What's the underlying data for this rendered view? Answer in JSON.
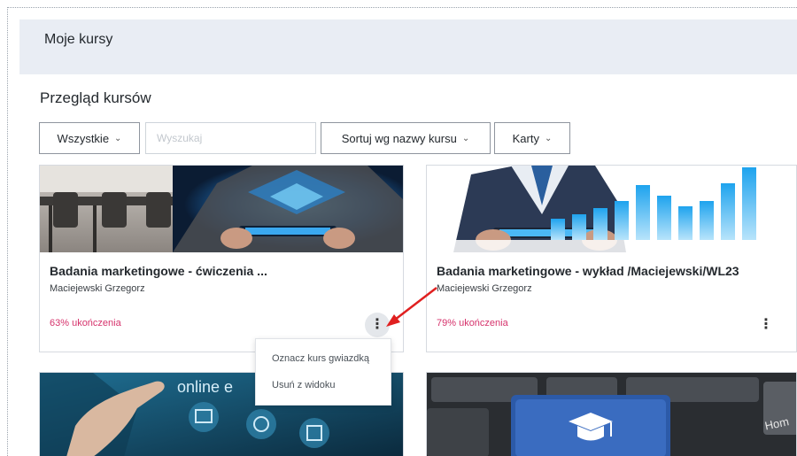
{
  "header": {
    "title": "Moje kursy"
  },
  "overview": {
    "title": "Przegląd kursów",
    "filter_label": "Wszystkie",
    "search_placeholder": "Wyszukaj",
    "sort_label": "Sortuj wg nazwy kursu",
    "view_label": "Karty"
  },
  "courses": [
    {
      "title": "Badania marketingowe - ćwiczenia ...",
      "author": "Maciejewski Grzegorz",
      "progress": "63% ukończenia"
    },
    {
      "title": "Badania marketingowe - wykład /Maciejewski/WL23",
      "author": "Maciejewski Grzegorz",
      "progress": "79% ukończenia"
    }
  ],
  "course_menu": {
    "items": [
      "Oznacz kurs gwiazdką",
      "Usuń z widoku"
    ]
  },
  "thumbnail_text": {
    "card3": "online e",
    "card4": "Hom"
  },
  "colors": {
    "progress": "#d6336c",
    "header_bg": "#e9edf4",
    "arrow": "#e02020"
  },
  "icons": {
    "chevron": "chevron-down-icon",
    "kebab": "more-vertical-icon"
  }
}
